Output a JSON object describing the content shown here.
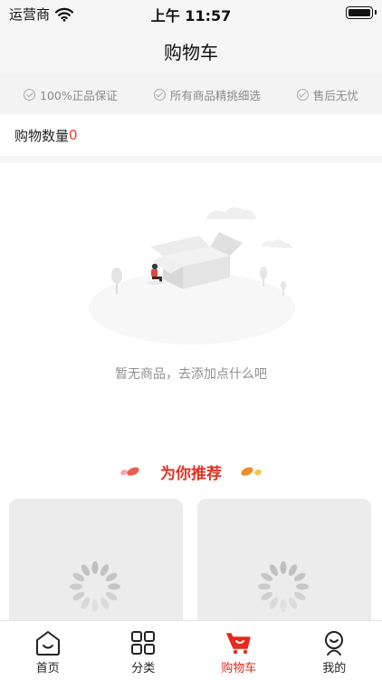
{
  "status_bar": {
    "carrier": "运营商",
    "time": "上午 11:57"
  },
  "nav": {
    "title": "购物车"
  },
  "guarantees": [
    {
      "label": "100%正品保证"
    },
    {
      "label": "所有商品精挑细选"
    },
    {
      "label": "售后无忧"
    }
  ],
  "cart": {
    "count_label": "购物数量",
    "count_value": "0"
  },
  "empty_state": {
    "message": "暂无商品，去添加点什么吧"
  },
  "recommend": {
    "title": "为你推荐"
  },
  "tabs": [
    {
      "label": "首页",
      "icon": "home-icon"
    },
    {
      "label": "分类",
      "icon": "category-grid-icon"
    },
    {
      "label": "购物车",
      "icon": "cart-icon",
      "active": true
    },
    {
      "label": "我的",
      "icon": "profile-icon"
    }
  ],
  "colors": {
    "accent": "#e8281c",
    "count_red": "#f13b30",
    "card_bg": "#ececec"
  }
}
